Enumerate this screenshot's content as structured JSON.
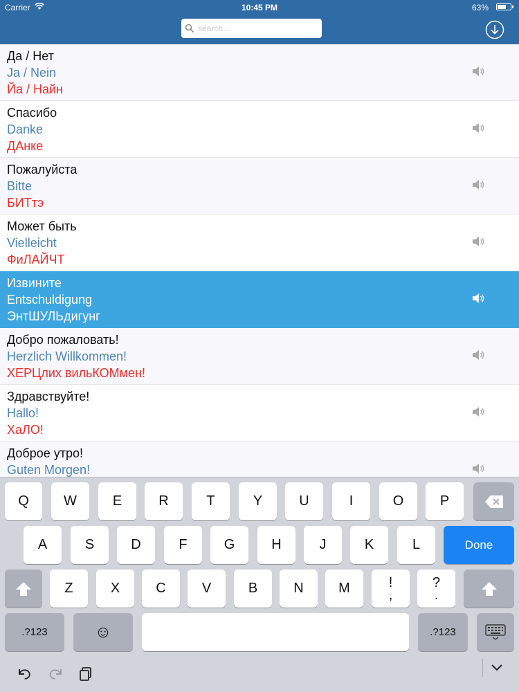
{
  "status_bar": {
    "carrier": "Carrier",
    "time": "10:45 PM",
    "battery": "63%"
  },
  "search": {
    "placeholder": "search...",
    "value": ""
  },
  "icons": {
    "search": "magnifier-icon",
    "download": "download-circle-icon",
    "speaker": "speaker-icon"
  },
  "phrases": [
    {
      "native": "Да / Нет",
      "foreign": "Ja / Nein",
      "translit": "Йа / Найн"
    },
    {
      "native": "Спасибо",
      "foreign": "Danke",
      "translit": "ДАнке"
    },
    {
      "native": "Пожалуйста",
      "foreign": "Bitte",
      "translit": "БИТтэ"
    },
    {
      "native": "Может быть",
      "foreign": "Vielleicht",
      "translit": "ФиЛАЙЧТ"
    },
    {
      "native": "Извините",
      "foreign": "Entschuldigung",
      "translit": "ЭнтШУЛЬдигунг"
    },
    {
      "native": "Добро пожаловать!",
      "foreign": "Herzlich Willkommen!",
      "translit": "ХЕРЦлих вильКОМмен!"
    },
    {
      "native": "Здравствуйте!",
      "foreign": "Hallo!",
      "translit": "ХаЛО!"
    },
    {
      "native": "Доброе утро!",
      "foreign": "Guten Morgen!",
      "translit": ""
    }
  ],
  "selected_index": 4,
  "colors": {
    "header": "#2f6ba5",
    "selected_row": "#3da6e1",
    "foreign_text": "#4d86b8",
    "translit_text": "#e8302b",
    "done_key": "#1a84f5"
  },
  "keyboard": {
    "row1": [
      "Q",
      "W",
      "E",
      "R",
      "T",
      "Y",
      "U",
      "I",
      "O",
      "P"
    ],
    "row2": [
      "A",
      "S",
      "D",
      "F",
      "G",
      "H",
      "J",
      "K",
      "L"
    ],
    "row3": [
      "Z",
      "X",
      "C",
      "V",
      "B",
      "N",
      "M"
    ],
    "punct1": [
      "!",
      ","
    ],
    "punct2": [
      "?",
      "."
    ],
    "done_label": "Done",
    "numbers_label": ".?123",
    "emoji": "☺"
  }
}
